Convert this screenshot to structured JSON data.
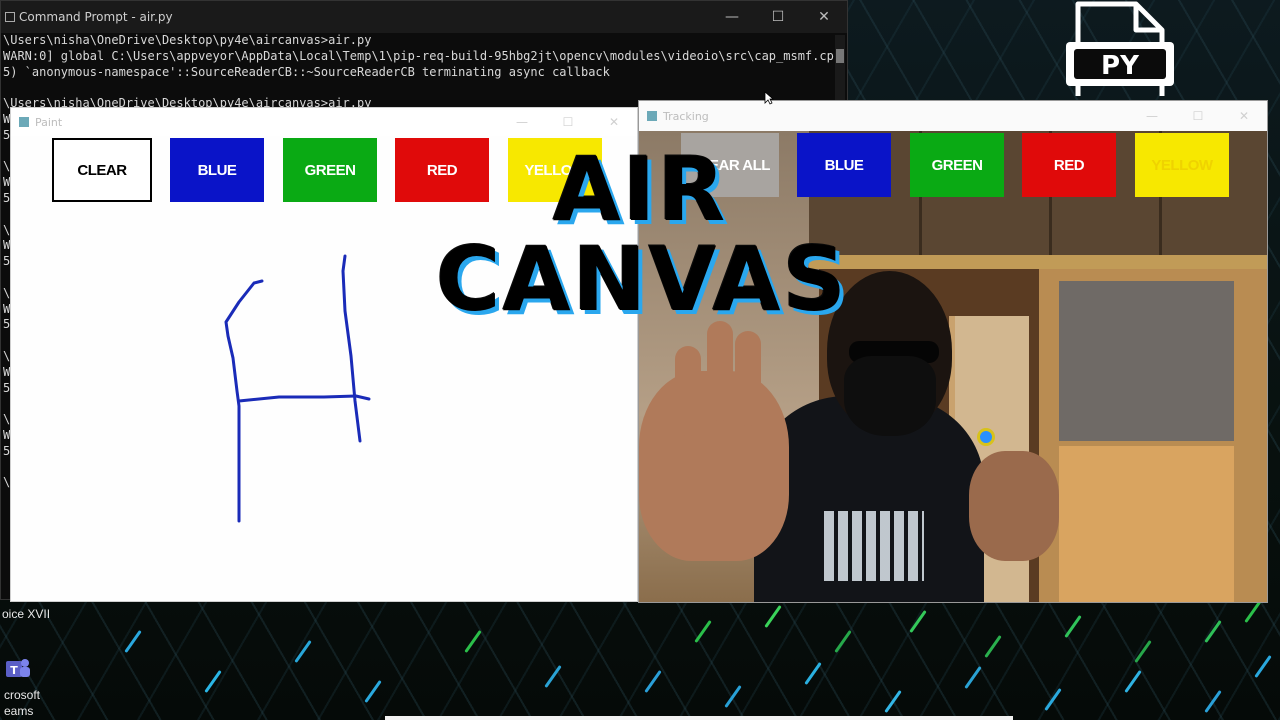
{
  "command_prompt": {
    "title": "Command Prompt - air.py",
    "lines": [
      "\\Users\\nisha\\OneDrive\\Desktop\\py4e\\aircanvas>air.py",
      "WARN:0] global C:\\Users\\appveyor\\AppData\\Local\\Temp\\1\\pip-req-build-95hbg2jt\\opencv\\modules\\videoio\\src\\cap_msmf.cpp (",
      "5) `anonymous-namespace'::SourceReaderCB::~SourceReaderCB terminating async callback",
      "",
      "\\Users\\nisha\\OneDrive\\Desktop\\py4e\\aircanvas>air.py",
      "WA",
      "5)",
      "",
      "\\U",
      "WA",
      "5)",
      "",
      "\\U",
      "WA",
      "5)",
      "",
      "\\U",
      "WA",
      "5)",
      "",
      "\\U",
      "WA",
      "5)",
      "",
      "\\U",
      "WA",
      "5)",
      "",
      "\\U"
    ],
    "controls": {
      "minimize": "—",
      "maximize": "☐",
      "close": "✕"
    }
  },
  "paint_window": {
    "title": "Paint",
    "buttons": [
      {
        "label": "CLEAR",
        "bg": "#ffffff",
        "fg": "#000000"
      },
      {
        "label": "BLUE",
        "bg": "#0a14c8",
        "fg": "#ffffff"
      },
      {
        "label": "GREEN",
        "bg": "#0aaa14",
        "fg": "#ffffff"
      },
      {
        "label": "RED",
        "bg": "#e00a0a",
        "fg": "#ffffff"
      },
      {
        "label": "YELLOW",
        "bg": "#f7e800",
        "fg": "#ffffff"
      }
    ],
    "stroke_color": "#1a2bb8",
    "drawn_letter": "H"
  },
  "tracking_window": {
    "title": "Tracking",
    "buttons": [
      {
        "label": "CLEAR ALL",
        "bg": "#a8a4a0",
        "fg": "#ffffff"
      },
      {
        "label": "BLUE",
        "bg": "#0a14c8",
        "fg": "#ffffff"
      },
      {
        "label": "GREEN",
        "bg": "#0aaa14",
        "fg": "#ffffff"
      },
      {
        "label": "RED",
        "bg": "#e00a0a",
        "fg": "#ffffff"
      },
      {
        "label": "YELLOW",
        "bg": "#f7e800",
        "fg": "#efd300"
      }
    ],
    "pointer_color": "#2a90ff"
  },
  "headline": {
    "line1": "AIR",
    "line2": "CANVAS"
  },
  "py_logo": {
    "text": "PY"
  },
  "desktop": {
    "label_voice": "oice XVII",
    "label_teams_1": "crosoft",
    "label_teams_2": "eams"
  },
  "colors": {
    "headline_shadow": "#2aa7ee",
    "background": "#0b1418"
  }
}
